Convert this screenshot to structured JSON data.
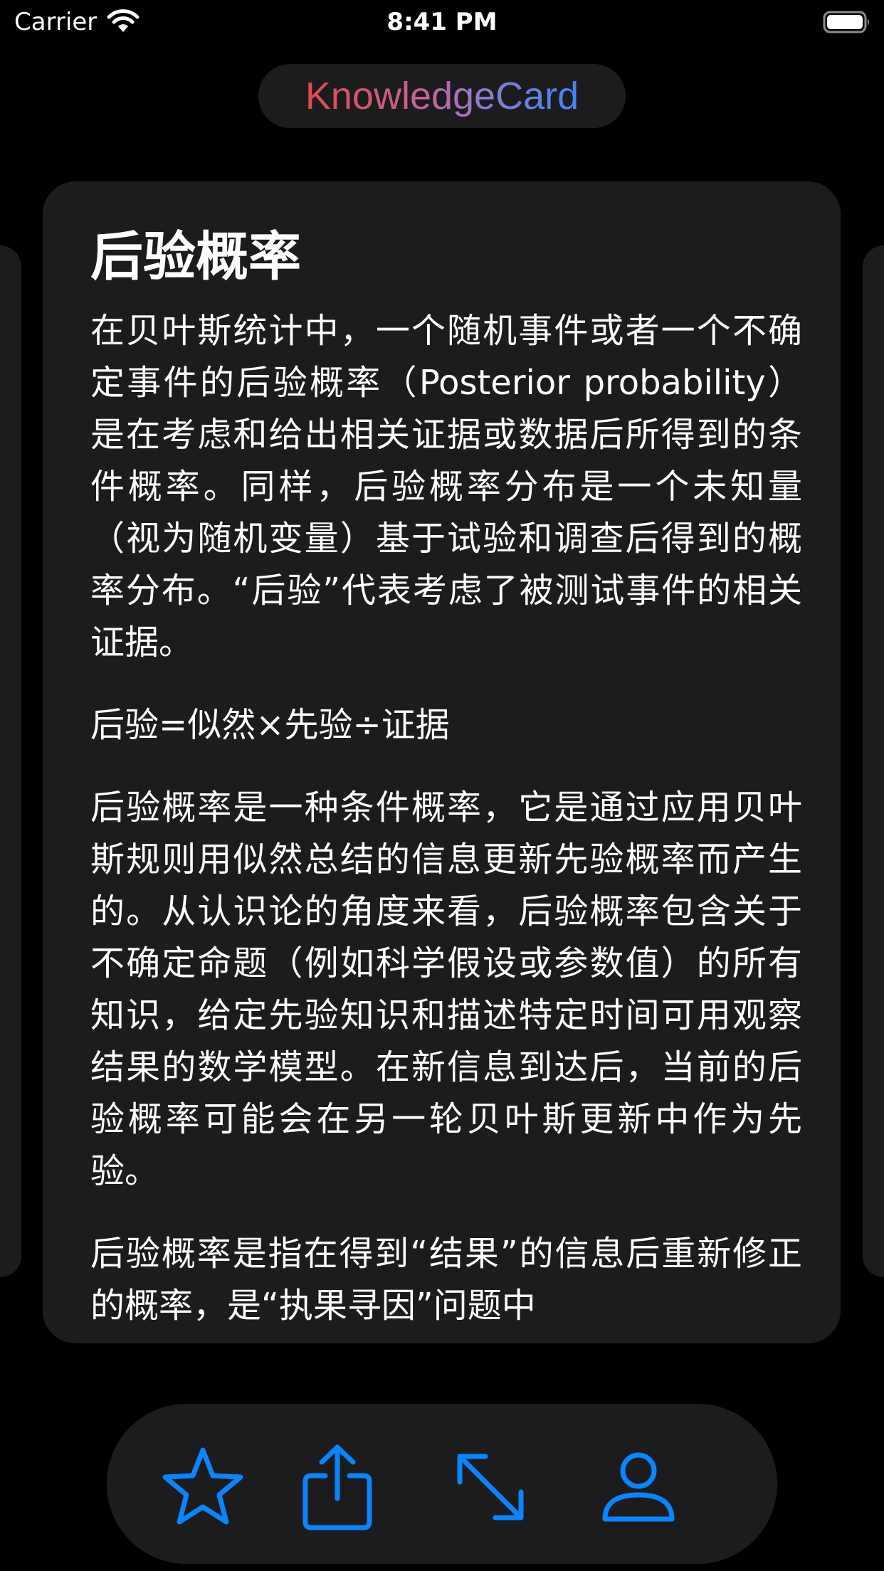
{
  "status_bar": {
    "carrier": "Carrier",
    "time": "8:41 PM",
    "wifi_icon": "wifi-icon",
    "battery_icon": "battery-full-icon"
  },
  "header": {
    "title": "KnowledgeCard"
  },
  "card": {
    "title": "后验概率",
    "paragraphs": [
      "在贝叶斯统计中，一个随机事件或者一个不确定事件的后验概率（Posterior probability）是在考虑和给出相关证据或数据后所得到的条件概率。同样，后验概率分布是一个未知量（视为随机变量）基于试验和调查后得到的概率分布。“后验”代表考虑了被测试事件的相关证据。",
      "后验=似然×先验÷证据",
      "后验概率是一种条件概率，它是通过应用贝叶斯规则用似然总结的信息更新先验概率而产生的。从认识论的角度来看，后验概率包含关于不确定命题（例如科学假设或参数值）的所有知识，给定先验知识和描述特定时间可用观察结果的数学模型。在新信息到达后，当前的后验概率可能会在另一轮贝叶斯更新中作为先验。",
      "后验概率是指在得到“结果”的信息后重新修正的概率，是“执果寻因”问题中"
    ]
  },
  "toolbar": {
    "items": [
      {
        "icon": "star-icon"
      },
      {
        "icon": "share-icon"
      },
      {
        "icon": "expand-icon"
      },
      {
        "icon": "person-icon"
      }
    ]
  },
  "colors": {
    "background": "#000000",
    "card": "#1c1c1e",
    "accent": "#0a84ff",
    "title_gradient_start": "#e5484d",
    "title_gradient_end": "#3f86f2"
  }
}
